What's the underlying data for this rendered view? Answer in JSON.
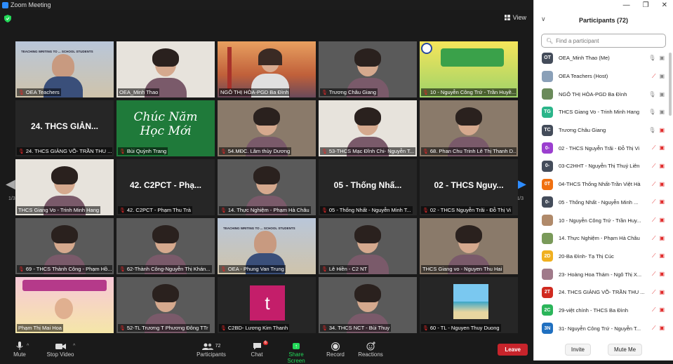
{
  "window": {
    "title": "Zoom Meeting"
  },
  "stage": {
    "view_label": "View",
    "page_left": "1/3",
    "page_right": "1/3",
    "tiles": [
      {
        "name": "OEA Teachers",
        "muted": true,
        "big": "",
        "kind": "slide-teach"
      },
      {
        "name": "OEA_Minh Thao",
        "muted": false,
        "big": "",
        "kind": "person-light"
      },
      {
        "name": "NGÔ THỊ HÒA-PGD Ba Đình",
        "muted": false,
        "big": "",
        "kind": "bridge"
      },
      {
        "name": "Trương Châu Giang",
        "muted": true,
        "big": "",
        "kind": "person-dark"
      },
      {
        "name": "10 - Nguyễn Công Trứ - Trần Huyề...",
        "muted": true,
        "big": "",
        "kind": "poster"
      },
      {
        "name": "24. THCS GIẢNG VÕ- TRẦN THU ...",
        "muted": true,
        "big": "24. THCS GIẢN...",
        "kind": "text"
      },
      {
        "name": "Bùi Quỳnh Trang",
        "muted": true,
        "big": "",
        "kind": "chalk"
      },
      {
        "name": "54.MĐC. Lâm thùy Dương",
        "muted": true,
        "big": "",
        "kind": "person-room"
      },
      {
        "name": "53-THCS Mạc Đĩnh Chi- Nguyễn T...",
        "muted": true,
        "big": "",
        "kind": "person-light"
      },
      {
        "name": "68. Phan Chu Trinh Lê Thị Thanh D...",
        "muted": true,
        "big": "",
        "kind": "person-room"
      },
      {
        "name": "THCS Giang Vo - Trinh Minh Hang",
        "muted": false,
        "big": "",
        "kind": "person-light"
      },
      {
        "name": "42. C2PCT - Phạm Thu Trà",
        "muted": true,
        "big": "42. C2PCT - Phạ...",
        "kind": "text"
      },
      {
        "name": "14. Thực Nghiệm - Phạm Hà Châu",
        "muted": true,
        "big": "",
        "kind": "person-dark"
      },
      {
        "name": "05 - Thống Nhất - Nguyễn Minh T...",
        "muted": true,
        "big": "05 - Thống Nhấ...",
        "kind": "text"
      },
      {
        "name": "02 - THCS Nguyễn Trãi - Đỗ Thị Vi",
        "muted": true,
        "big": "02 - THCS Nguy...",
        "kind": "text"
      },
      {
        "name": "69 - THCS Thành Công - Phạm Hồ...",
        "muted": true,
        "big": "",
        "kind": "person-dark"
      },
      {
        "name": "62-Thành Công-Nguyễn Thị Khán...",
        "muted": true,
        "big": "",
        "kind": "person-dark"
      },
      {
        "name": "OEA - Phung Van Trung",
        "muted": true,
        "big": "",
        "kind": "slide-teach"
      },
      {
        "name": "Lê Hiền - C2 NT",
        "muted": true,
        "big": "",
        "kind": "person-dark"
      },
      {
        "name": "THCS Giang vo - Nguyen Thu Hai",
        "muted": false,
        "big": "",
        "kind": "person-room"
      },
      {
        "name": "Phạm Thị Mai Hoa",
        "muted": false,
        "big": "",
        "kind": "poster2"
      },
      {
        "name": "52-TL Trương T Phương Đông TTr",
        "muted": true,
        "big": "",
        "kind": "person-dark"
      },
      {
        "name": "C2BD- Lương Kim Thanh",
        "muted": true,
        "big": "",
        "kind": "letter"
      },
      {
        "name": "34. THCS NCT - Bùi Thuy",
        "muted": true,
        "big": "",
        "kind": "person-dark"
      },
      {
        "name": "60 - TL - Nguyen Thuy Duong",
        "muted": true,
        "big": "",
        "kind": "beach"
      }
    ],
    "chalk_text": "Chúc Năm Học Mới",
    "letter_char": "t",
    "slide_caption": "TEACHING WRITING TO ... SCHOOL STUDENTS"
  },
  "toolbar": {
    "mute": "Mute",
    "stop_video": "Stop Video",
    "participants": "Participants",
    "participants_count": "72",
    "chat": "Chat",
    "chat_badge": "6",
    "share_screen": "Share Screen",
    "record": "Record",
    "reactions": "Reactions",
    "leave": "Leave"
  },
  "panel": {
    "title": "Participants (72)",
    "search_placeholder": "Find a participant",
    "invite": "Invite",
    "mute_me": "Mute Me",
    "participants": [
      {
        "initials": "OT",
        "color": "#444c5a",
        "name": "OEA_Minh Thao (Me)",
        "mic_muted": false,
        "video_off": false
      },
      {
        "initials": "",
        "color": "#8aa0b8",
        "name": "OEA Teachers (Host)",
        "mic_muted": true,
        "video_off": false
      },
      {
        "initials": "",
        "color": "#6a8a5a",
        "name": "NGÔ THỊ HÒA-PGD Ba Đình",
        "mic_muted": false,
        "video_off": false
      },
      {
        "initials": "TG",
        "color": "#2bb58a",
        "name": "THCS Giang Vo - Trinh Minh Hang",
        "mic_muted": false,
        "video_off": false
      },
      {
        "initials": "TC",
        "color": "#444c5a",
        "name": "Trương Châu Giang",
        "mic_muted": false,
        "video_off": true
      },
      {
        "initials": "0-",
        "color": "#9b3fcf",
        "name": "02 - THCS Nguyễn Trãi - Đỗ Thị Vi",
        "mic_muted": true,
        "video_off": true
      },
      {
        "initials": "0-",
        "color": "#444c5a",
        "name": "03-C2HHT - Nguyễn Thị Thuý Liên",
        "mic_muted": true,
        "video_off": true
      },
      {
        "initials": "0T",
        "color": "#f07010",
        "name": "04-THCS Thống Nhất-Trần Việt Hà",
        "mic_muted": true,
        "video_off": true
      },
      {
        "initials": "0-",
        "color": "#444c5a",
        "name": "05 - Thống Nhất - Nguyễn Minh ...",
        "mic_muted": true,
        "video_off": true
      },
      {
        "initials": "",
        "color": "#b08a6a",
        "name": "10 - Nguyễn Công Trứ - Trần Huy...",
        "mic_muted": true,
        "video_off": true
      },
      {
        "initials": "",
        "color": "#7a9a5a",
        "name": "14. Thực Nghiệm - Phạm Hà Châu",
        "mic_muted": true,
        "video_off": true
      },
      {
        "initials": "2D",
        "color": "#f0b020",
        "name": "20-Ba Đình- Tạ Thị Cúc",
        "mic_muted": true,
        "video_off": true
      },
      {
        "initials": "",
        "color": "#a07a8a",
        "name": "23- Hoàng Hoa Thám - Ngô Thị X...",
        "mic_muted": true,
        "video_off": true
      },
      {
        "initials": "2T",
        "color": "#d02a20",
        "name": "24. THCS GIẢNG VÕ- TRẦN THU ...",
        "mic_muted": true,
        "video_off": true
      },
      {
        "initials": "2C",
        "color": "#2bb55a",
        "name": "29-việt chính - THCS Ba Đình",
        "mic_muted": true,
        "video_off": true
      },
      {
        "initials": "3N",
        "color": "#2070c0",
        "name": "31- Nguyễn Công Trứ - Nguyễn T...",
        "mic_muted": true,
        "video_off": true
      }
    ]
  }
}
